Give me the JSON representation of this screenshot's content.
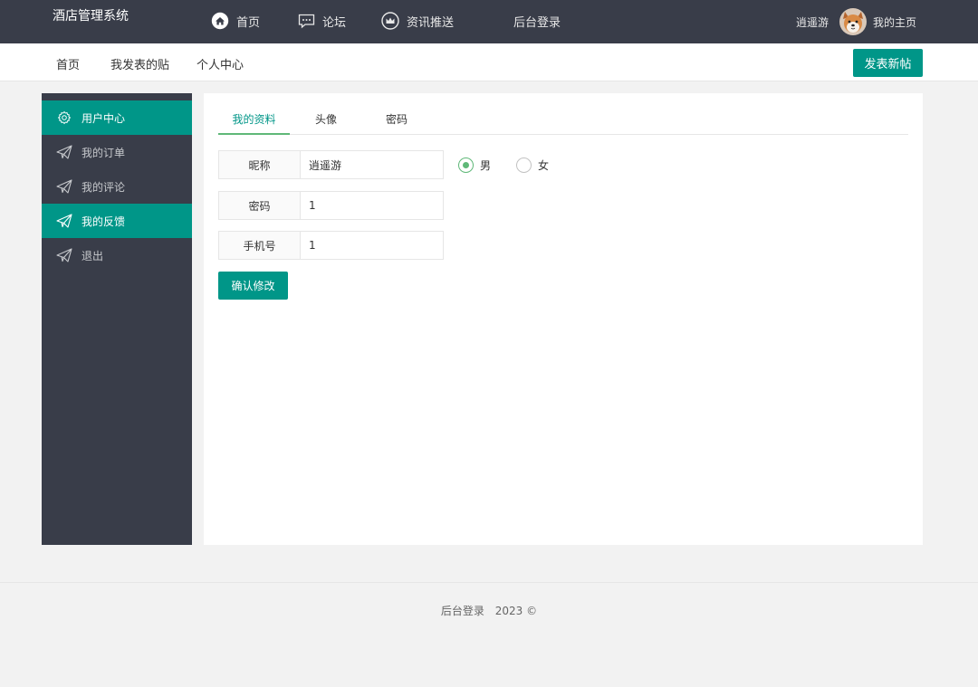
{
  "header": {
    "logo": "酒店管理系统",
    "nav": [
      {
        "label": "首页",
        "icon": "home-icon"
      },
      {
        "label": "论坛",
        "icon": "chat-icon"
      },
      {
        "label": "资讯推送",
        "icon": "crown-icon"
      },
      {
        "label": "后台登录"
      }
    ],
    "user_name": "逍遥游",
    "my_home": "我的主页"
  },
  "subnav": {
    "items": [
      "首页",
      "我发表的贴",
      "个人中心"
    ],
    "post_button": "发表新帖"
  },
  "sidebar": {
    "items": [
      {
        "label": "用户中心",
        "icon": "gear-icon",
        "active": true
      },
      {
        "label": "我的订单",
        "icon": "paper-plane-icon",
        "active": false
      },
      {
        "label": "我的评论",
        "icon": "paper-plane-icon",
        "active": false
      },
      {
        "label": "我的反馈",
        "icon": "paper-plane-icon",
        "active": true
      },
      {
        "label": "退出",
        "icon": "paper-plane-icon",
        "active": false
      }
    ]
  },
  "main": {
    "tabs": [
      "我的资料",
      "头像",
      "密码"
    ],
    "active_tab": "我的资料",
    "form": {
      "nickname_label": "昵称",
      "nickname_value": "逍遥游",
      "password_label": "密码",
      "password_value": "1",
      "phone_label": "手机号",
      "phone_value": "1"
    },
    "gender": {
      "options": [
        "男",
        "女"
      ],
      "selected": "男"
    },
    "confirm_button": "确认修改"
  },
  "footer": {
    "link": "后台登录",
    "copyright": "2023 ©"
  },
  "colors": {
    "header_bg": "#393d49",
    "accent": "#009688",
    "radio_green": "#5fb878"
  }
}
